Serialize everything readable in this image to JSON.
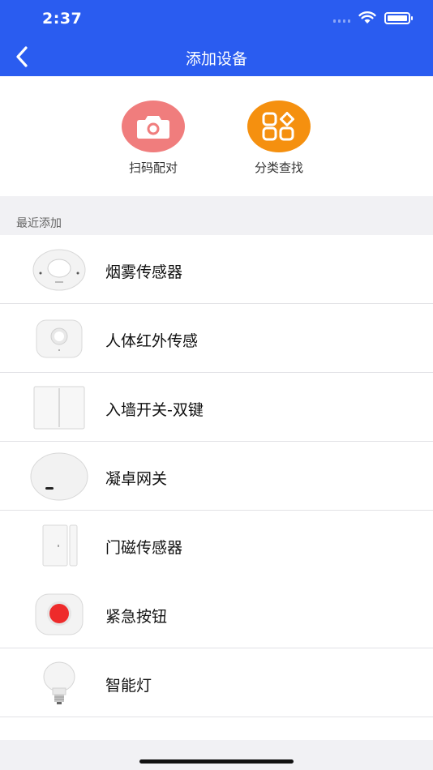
{
  "status_bar": {
    "time": "2:37"
  },
  "header": {
    "title": "添加设备"
  },
  "actions": [
    {
      "label": "扫码配对",
      "icon": "camera-icon",
      "color": "#f07d7d"
    },
    {
      "label": "分类查找",
      "icon": "category-grid-icon",
      "color": "#f5900f"
    }
  ],
  "section": {
    "title": "最近添加"
  },
  "devices": [
    {
      "name": "烟雾传感器",
      "icon": "smoke-sensor-icon"
    },
    {
      "name": "人体红外传感",
      "icon": "motion-sensor-icon"
    },
    {
      "name": "入墙开关-双键",
      "icon": "wall-switch-icon"
    },
    {
      "name": "凝卓网关",
      "icon": "gateway-icon"
    },
    {
      "name": "门磁传感器",
      "icon": "door-sensor-icon"
    },
    {
      "name": "紧急按钮",
      "icon": "emergency-button-icon"
    },
    {
      "name": "智能灯",
      "icon": "smart-bulb-icon"
    }
  ],
  "colors": {
    "header_bg": "#2a5cf0",
    "section_bg": "#f1f1f4"
  }
}
